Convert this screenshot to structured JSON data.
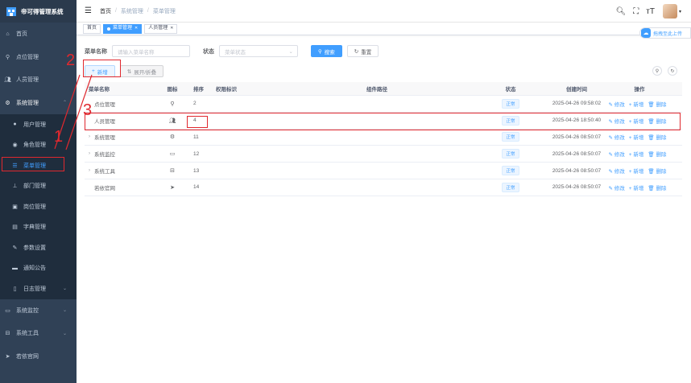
{
  "app": {
    "title": "帝可得管理系统"
  },
  "sidebar": {
    "items": [
      {
        "label": "首页",
        "icon": "home-icon"
      },
      {
        "label": "点位管理",
        "icon": "location-icon"
      },
      {
        "label": "人员管理",
        "icon": "users-icon"
      },
      {
        "label": "系统管理",
        "icon": "gear-icon"
      },
      {
        "label": "用户管理",
        "icon": "user-icon"
      },
      {
        "label": "角色管理",
        "icon": "role-icon"
      },
      {
        "label": "菜单管理",
        "icon": "tree-table-icon"
      },
      {
        "label": "部门管理",
        "icon": "tree-icon"
      },
      {
        "label": "岗位管理",
        "icon": "post-icon"
      },
      {
        "label": "字典管理",
        "icon": "dict-icon"
      },
      {
        "label": "参数设置",
        "icon": "edit-icon"
      },
      {
        "label": "通知公告",
        "icon": "message-icon"
      },
      {
        "label": "日志管理",
        "icon": "log-icon"
      },
      {
        "label": "系统监控",
        "icon": "monitor-icon"
      },
      {
        "label": "系统工具",
        "icon": "tool-icon"
      },
      {
        "label": "若依官网",
        "icon": "guide-icon"
      }
    ]
  },
  "breadcrumb": {
    "home": "首页",
    "level1": "系统管理",
    "level2": "菜单管理"
  },
  "tags": {
    "home": "首页",
    "menu": "菜单管理",
    "users": "人员管理"
  },
  "float": {
    "label": "拖拽至此上传"
  },
  "search": {
    "name_label": "菜单名称",
    "name_placeholder": "请输入菜单名称",
    "status_label": "状态",
    "status_placeholder": "菜单状态",
    "search_btn": "搜索",
    "reset_btn": "重置"
  },
  "toolbar": {
    "add_btn": "新增",
    "toggle_btn": "展开/折叠"
  },
  "table": {
    "headers": {
      "name": "菜单名称",
      "icon": "图标",
      "sort": "排序",
      "perm": "权限标识",
      "comp": "组件路径",
      "status": "状态",
      "time": "创建时间",
      "ops": "操作"
    },
    "ops": {
      "edit": "修改",
      "add": "新增",
      "del": "删除"
    },
    "rows": [
      {
        "name": "点位管理",
        "icon": "location-icon",
        "sort": "2",
        "status": "正常",
        "time": "2025-04-26 09:58:02",
        "expand": false
      },
      {
        "name": "人员管理",
        "icon": "users-icon",
        "sort": "4",
        "status": "正常",
        "time": "2025-04-26 18:50:40",
        "expand": false
      },
      {
        "name": "系统管理",
        "icon": "gear-icon",
        "sort": "11",
        "status": "正常",
        "time": "2025-04-26 08:50:07",
        "expand": true
      },
      {
        "name": "系统监控",
        "icon": "monitor-icon",
        "sort": "12",
        "status": "正常",
        "time": "2025-04-26 08:50:07",
        "expand": true
      },
      {
        "name": "系统工具",
        "icon": "tool-icon",
        "sort": "13",
        "status": "正常",
        "time": "2025-04-26 08:50:07",
        "expand": true
      },
      {
        "name": "若依官网",
        "icon": "guide-icon",
        "sort": "14",
        "status": "正常",
        "time": "2025-04-26 08:50:07",
        "expand": false
      }
    ]
  },
  "annotations": {
    "n1": "1",
    "n2": "2",
    "n3": "3"
  }
}
